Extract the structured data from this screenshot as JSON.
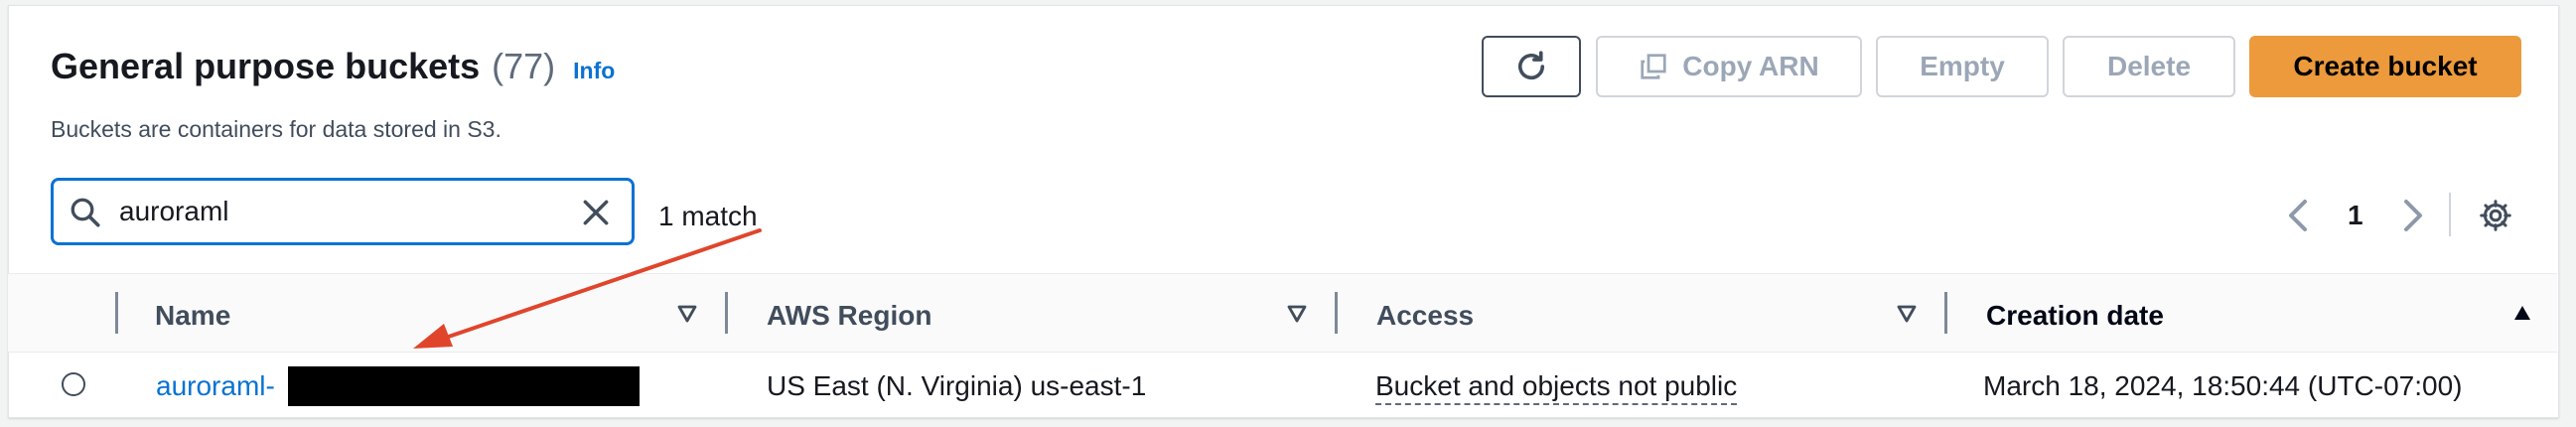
{
  "header": {
    "title": "General purpose buckets",
    "count": "(77)",
    "info_link": "Info",
    "description": "Buckets are containers for data stored in S3."
  },
  "toolbar": {
    "refresh_icon": "refresh-icon",
    "copy_arn_label": "Copy ARN",
    "copy_icon": "copy-icon",
    "empty_label": "Empty",
    "delete_label": "Delete",
    "create_label": "Create bucket",
    "accent_color": "#ec9a3c"
  },
  "search": {
    "value": "auroraml",
    "search_icon": "search-icon",
    "clear_icon": "close-icon",
    "result_text": "1 match"
  },
  "pagination": {
    "page": "1",
    "prev_icon": "chevron-left-icon",
    "next_icon": "chevron-right-icon",
    "settings_icon": "gear-icon"
  },
  "table": {
    "columns": [
      {
        "label": "Name",
        "filter_icon": "filter-icon"
      },
      {
        "label": "AWS Region",
        "filter_icon": "filter-icon"
      },
      {
        "label": "Access",
        "filter_icon": "filter-icon"
      },
      {
        "label": "Creation date",
        "sort_icon": "sort-ascending-icon"
      }
    ],
    "rows": [
      {
        "name": "auroraml-",
        "region": "US East (N. Virginia) us-east-1",
        "access": "Bucket and objects not public",
        "created": "March 18, 2024, 18:50:44 (UTC-07:00)"
      }
    ]
  },
  "annotation": {
    "arrow_color": "#e0452c"
  }
}
